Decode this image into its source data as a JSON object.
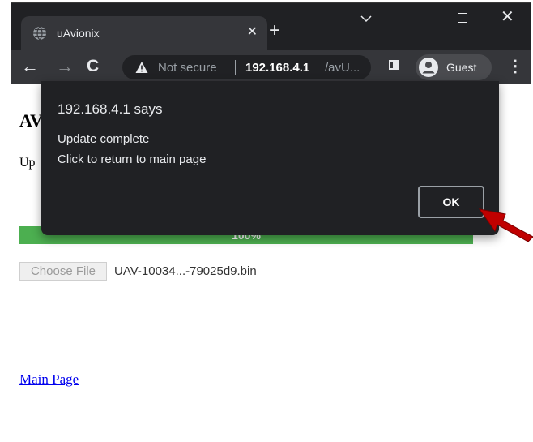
{
  "browser": {
    "tab": {
      "title": "uAvionix",
      "close_glyph": "✕",
      "favicon": "globe-icon"
    },
    "new_tab_glyph": "+",
    "window_controls": {
      "minimize": "minimize-icon",
      "maximize": "maximize-icon",
      "close_glyph": "✕"
    },
    "nav": {
      "back_glyph": "←",
      "forward_glyph": "→",
      "reload_glyph": "C"
    },
    "address": {
      "security_text": "Not secure",
      "host": "192.168.4.1",
      "path": "/avU..."
    },
    "profile": {
      "label": "Guest"
    },
    "menu_glyph": "⋮"
  },
  "page": {
    "heading_visible": "AV",
    "status_visible": "Up",
    "progress": {
      "label": "100%",
      "percent": 100
    },
    "file_input": {
      "button_label": "Choose File",
      "file_name": "UAV-10034...-79025d9.bin"
    },
    "link": "Main Page"
  },
  "dialog": {
    "title": "192.168.4.1 says",
    "line1": "Update complete",
    "line2": "Click to return to main page",
    "ok_label": "OK"
  },
  "colors": {
    "tabstrip": "#202124",
    "toolbar": "#35363a",
    "progress_fill": "#4caf50",
    "link": "#0000ee",
    "annotation_arrow": "#c00000"
  },
  "annotation": {
    "arrow": "red-arrow-pointing-at-ok"
  }
}
